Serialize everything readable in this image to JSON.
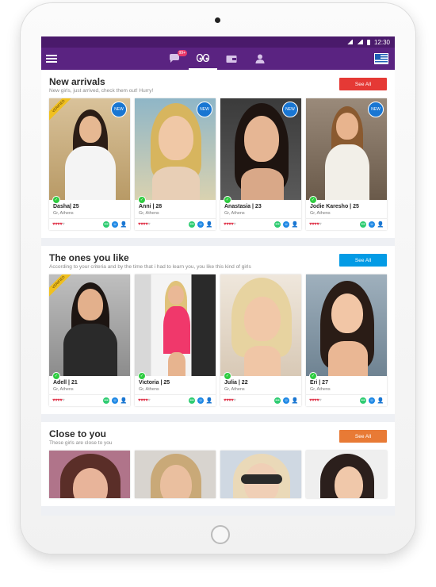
{
  "statusbar": {
    "time": "12:30"
  },
  "nav": {
    "chat_badge": "99+"
  },
  "sections": [
    {
      "title": "New arrivals",
      "subtitle": "New girls, just arrived, check them out! Hurry!",
      "button": "See All",
      "button_color": "#e53935",
      "cards": [
        {
          "name": "Dasha| 25",
          "location": "Gr, Athens",
          "hearts": 4,
          "verified": "VERIFIED",
          "new": "NEW"
        },
        {
          "name": "Anni | 28",
          "location": "Gr, Athens",
          "hearts": 4,
          "new": "NEW"
        },
        {
          "name": "Anastasia | 23",
          "location": "Gr, Athens",
          "hearts": 4,
          "new": "NEW"
        },
        {
          "name": "Jodie Karesho | 25",
          "location": "Gr, Athens",
          "hearts": 4,
          "new": "NEW"
        }
      ]
    },
    {
      "title": "The ones you like",
      "subtitle": "According to your criteria and by the time that i had to learn you, you like this kind of girls",
      "button": "See All",
      "button_color": "#039be5",
      "cards": [
        {
          "name": "Adell | 21",
          "location": "Gr, Athens",
          "hearts": 4,
          "verified": "VERIFIED"
        },
        {
          "name": "Victoria | 25",
          "location": "Gr, Athens",
          "hearts": 4
        },
        {
          "name": "Julia | 22",
          "location": "Gr, Athens",
          "hearts": 4
        },
        {
          "name": "Eri | 27",
          "location": "Gr, Athens",
          "hearts": 4
        }
      ]
    },
    {
      "title": "Close to you",
      "subtitle": "These girls are close to you",
      "button": "See All",
      "button_color": "#e87a35"
    }
  ],
  "icons": {
    "heart": "♥",
    "chat": "chat-icon",
    "smile": "smile-icon",
    "user": "user-icon"
  }
}
